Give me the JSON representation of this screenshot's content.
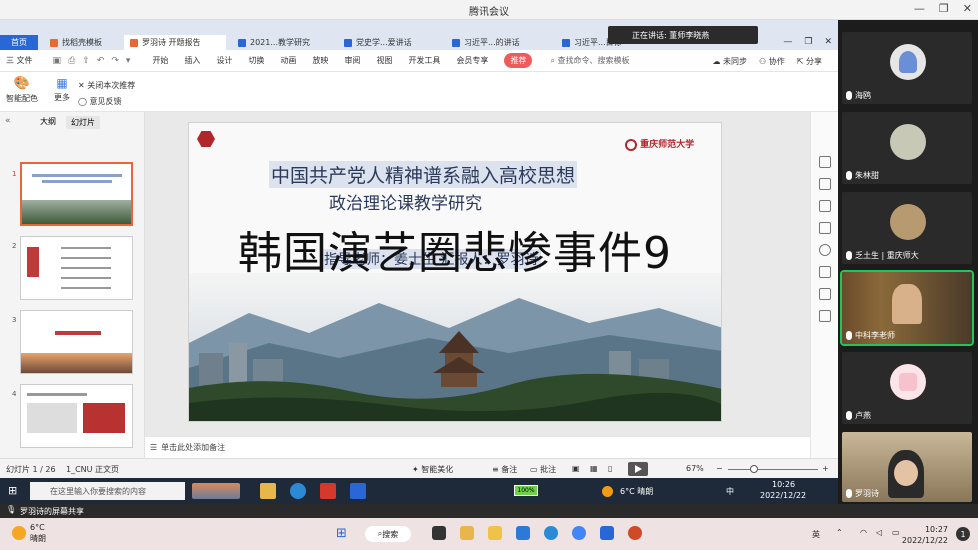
{
  "meeting": {
    "title": "腾讯会议",
    "speaking": "正在讲话: 董师李晓燕"
  },
  "wps": {
    "tabs": [
      {
        "label": "首页"
      },
      {
        "label": "找稻壳模板"
      },
      {
        "label": "罗羽诗 开题报告"
      },
      {
        "label": "2021...教学研究"
      },
      {
        "label": "党史学...爱讲话"
      },
      {
        "label": "习近平...的讲话"
      },
      {
        "label": "习近平...目标"
      }
    ],
    "menu": {
      "file": "三 文件",
      "items": [
        "开始",
        "插入",
        "设计",
        "切换",
        "动画",
        "放映",
        "审阅",
        "视图",
        "开发工具",
        "会员专享",
        "推荐"
      ],
      "search": "查找命令、搜索模板",
      "right": [
        "未同步",
        "协作",
        "分享"
      ]
    },
    "ribbon": {
      "smart_color": "智能配色",
      "more": "更多",
      "close_rec": "关闭本次推荐",
      "feedback": "意见反馈"
    },
    "left": {
      "tab_outline": "大纲",
      "tab_slides": "幻灯片",
      "numbers": [
        "1",
        "2",
        "3",
        "4"
      ],
      "add": "+"
    },
    "slide": {
      "university": "重庆师范大学",
      "title_line1": "中国共产党人精神谱系融入高校思想",
      "title_line2": "政治理论课教学研究",
      "subtitle": "指导老师：姜士生   汇报人：罗羽诗",
      "overlay": "韩国演艺圈悲惨事件9"
    },
    "notes": "单击此处添加备注",
    "status": {
      "slide_count": "幻灯片 1 / 26",
      "theme": "1_CNU 正文页",
      "smart": "智能美化",
      "notes_btn": "备注",
      "comments": "批注",
      "zoom": "67%"
    }
  },
  "participants": [
    {
      "name": "海鸥"
    },
    {
      "name": "朱林甜"
    },
    {
      "name": "乏土生 | 重庆师大"
    },
    {
      "name": "中科李老师"
    },
    {
      "name": "卢燕"
    },
    {
      "name": "罗羽诗"
    }
  ],
  "inner_taskbar": {
    "search": "在这里输入你要搜索的内容",
    "battery": "100%",
    "weather": "6°C 晴朗",
    "ime": "中",
    "time": "10:26",
    "date": "2022/12/22"
  },
  "share_bar": {
    "text": "罗羽诗的屏幕共享"
  },
  "os_taskbar": {
    "weather_temp": "6°C",
    "weather_desc": "晴朗",
    "search": "搜索",
    "lang": "英",
    "time": "10:27",
    "date": "2022/12/22",
    "badge": "1"
  }
}
